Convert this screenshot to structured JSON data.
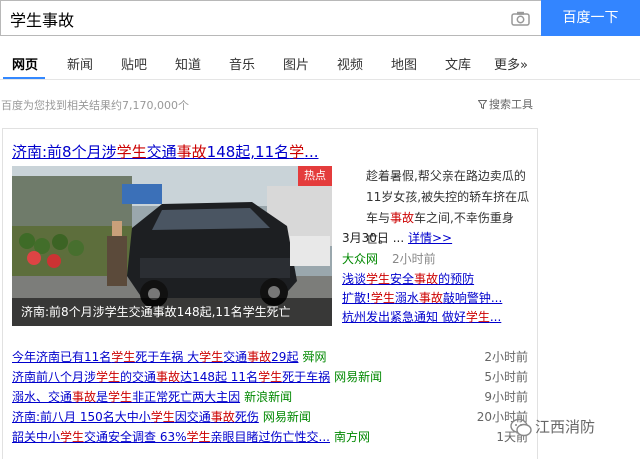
{
  "search": {
    "query": "学生事故",
    "button_label": "百度一下"
  },
  "tabs": [
    {
      "label": "网页",
      "active": true
    },
    {
      "label": "新闻"
    },
    {
      "label": "贴吧"
    },
    {
      "label": "知道"
    },
    {
      "label": "音乐"
    },
    {
      "label": "图片"
    },
    {
      "label": "视频"
    },
    {
      "label": "地图"
    },
    {
      "label": "文库"
    },
    {
      "label": "更多»"
    }
  ],
  "result_count": "百度为您找到相关结果约7,170,000个",
  "tools_label": "搜索工具",
  "card": {
    "title_parts": [
      "济南:前8个月涉",
      "学生",
      "交通",
      "事故",
      "148起,11名",
      "学",
      "..."
    ],
    "hot_label": "热点",
    "image_caption": "济南:前8个月涉学生交通事故148起,11名学生死亡",
    "summary_parts": [
      "趁着暑假,帮父亲在路边卖瓜的11岁女孩,被失控的轿车挤在瓜车与",
      "事故",
      "车之间,不幸伤重身亡。"
    ],
    "date": "3月30日 ...",
    "more_label": "详情>>",
    "source": "大众网",
    "source_time": "2小时前",
    "side_links": [
      {
        "parts": [
          "浅谈",
          "学生",
          "安全",
          "事故",
          "的预防"
        ]
      },
      {
        "parts": [
          "扩散!",
          "学生",
          "溺水",
          "事故",
          "敲响警钟..."
        ]
      },
      {
        "parts": [
          "杭州发出紧急通知 做好",
          "学生",
          "..."
        ]
      }
    ]
  },
  "list": [
    {
      "parts": [
        "今年济南已有11名",
        "学生",
        "死于车祸 大",
        "学生",
        "交通",
        "事故",
        "29起"
      ],
      "source": "舜网",
      "time": "2小时前"
    },
    {
      "parts": [
        "济南前八个月涉",
        "学生",
        "的交通",
        "事故",
        "达148起 11名",
        "学生",
        "死于车祸"
      ],
      "source": "网易新闻",
      "time": "5小时前"
    },
    {
      "parts": [
        "溺水、交通",
        "事故",
        "是",
        "学生",
        "非正常死亡两大主因"
      ],
      "source": "新浪新闻",
      "time": "9小时前"
    },
    {
      "parts": [
        "济南:前八月 150名大中小",
        "学生",
        "因交通",
        "事故",
        "死伤"
      ],
      "source": "网易新闻",
      "time": "20小时前"
    },
    {
      "parts": [
        "韶关中小",
        "学生",
        "交通安全调查 63%",
        "学生",
        "亲眼目睹过伤亡性交..."
      ],
      "source": "南方网",
      "time": "1天前"
    }
  ],
  "watermark": "江西消防",
  "colors": {
    "accent": "#3385ff",
    "link": "#0000cc",
    "highlight": "#cc0000",
    "source": "#008000"
  }
}
